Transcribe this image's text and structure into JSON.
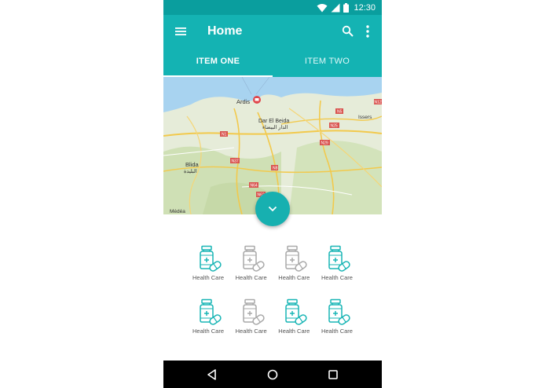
{
  "status_bar": {
    "time": "12:30"
  },
  "app_bar": {
    "title": "Home"
  },
  "tabs": [
    {
      "label": "ITEM ONE",
      "active": true
    },
    {
      "label": "ITEM TWO",
      "active": false
    }
  ],
  "map": {
    "labels": {
      "ardis": "Ardis",
      "dar_el_beida": "Dar El Beida",
      "dar_el_beida_ar": "الدار البيضاء",
      "blida": "Blida",
      "blida_ar": "البليدة",
      "isser": "Issers",
      "medea": "Médéa"
    },
    "roads": {
      "n1": "N1",
      "n37": "N37",
      "n8": "N8",
      "n64": "N64",
      "n5": "N5",
      "n25": "N25",
      "n29": "N29",
      "n12": "N12",
      "n62": "N62"
    }
  },
  "categories": [
    {
      "label": "Health Care",
      "style": "teal"
    },
    {
      "label": "Health Care",
      "style": "gray"
    },
    {
      "label": "Health Care",
      "style": "gray"
    },
    {
      "label": "Health Care",
      "style": "teal"
    },
    {
      "label": "Health Care",
      "style": "teal"
    },
    {
      "label": "Health Care",
      "style": "gray"
    },
    {
      "label": "Health Care",
      "style": "teal"
    },
    {
      "label": "Health Care",
      "style": "teal"
    }
  ],
  "colors": {
    "primary": "#14b3b3",
    "primary_dark": "#0a9e9e",
    "icon_active": "#19b5b5",
    "icon_inactive": "#a9a9a9"
  }
}
